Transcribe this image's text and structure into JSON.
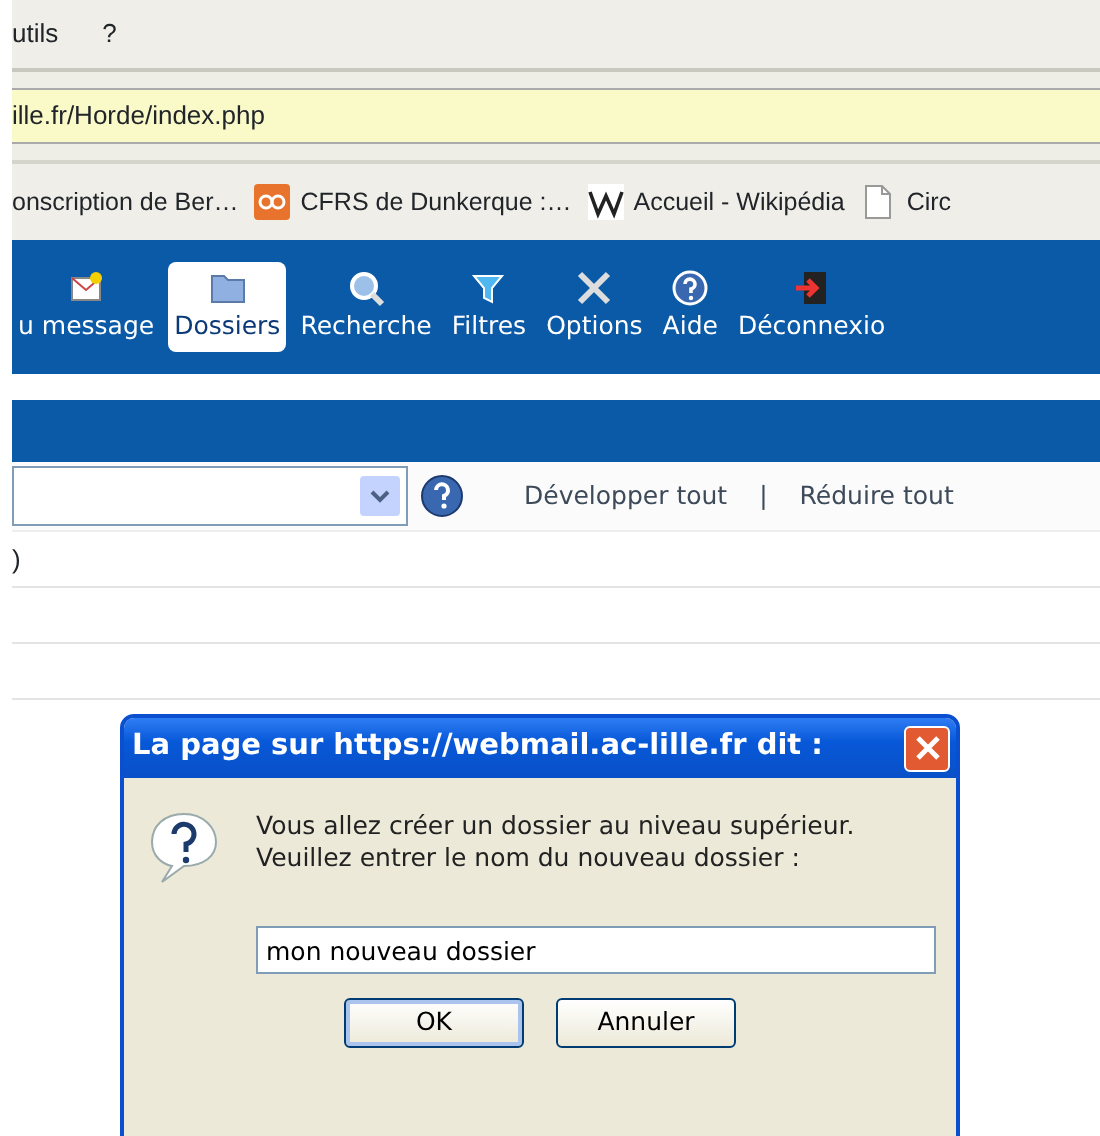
{
  "menu": [
    "utils",
    "?"
  ],
  "address": "ille.fr/Horde/index.php",
  "bookmarks": [
    {
      "label": "onscription de Ber…",
      "kind": "none"
    },
    {
      "label": "CFRS de Dunkerque :…",
      "kind": "orange"
    },
    {
      "label": "Accueil - Wikipédia",
      "kind": "wiki"
    },
    {
      "label": "Circ",
      "kind": "page"
    }
  ],
  "toolbar": [
    {
      "label": "u message",
      "kind": "mail",
      "selected": false
    },
    {
      "label": "Dossiers",
      "kind": "folder",
      "selected": true
    },
    {
      "label": "Recherche",
      "kind": "search",
      "selected": false
    },
    {
      "label": "Filtres",
      "kind": "filter",
      "selected": false
    },
    {
      "label": "Options",
      "kind": "tools",
      "selected": false
    },
    {
      "label": "Aide",
      "kind": "help",
      "selected": false
    },
    {
      "label": "Déconnexio",
      "kind": "logout",
      "selected": false
    }
  ],
  "folder_bar": {
    "links": [
      "Développer tout",
      "Réduire tout"
    ],
    "separator": "|"
  },
  "rows": [
    {
      "column_1": ")"
    }
  ],
  "dialog": {
    "title": "La page sur https://webmail.ac-lille.fr dit :",
    "message": [
      "Vous allez créer un dossier au niveau supérieur.",
      "Veuillez entrer le nom du nouveau dossier :"
    ],
    "value": "mon nouveau dossier",
    "buttons": [
      {
        "label": "OK",
        "selected": true
      },
      {
        "label": "Annuler",
        "selected": false
      }
    ]
  }
}
